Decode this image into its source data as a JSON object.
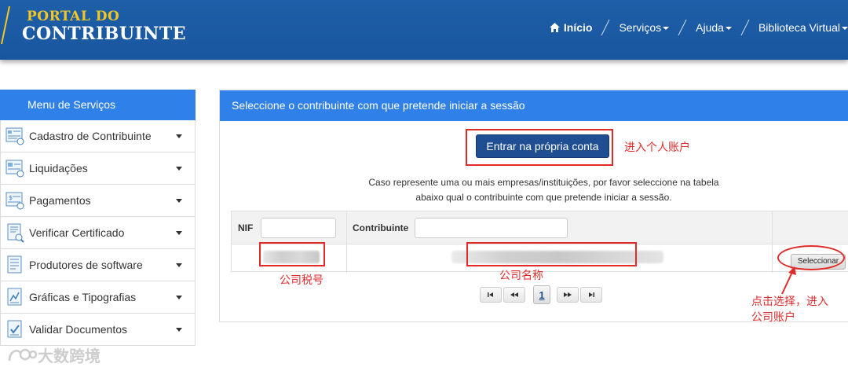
{
  "header": {
    "logo_top": "PORTAL DO",
    "logo_bottom": "CONTRIBUINTE",
    "nav": [
      {
        "label": "Início",
        "icon": "home-icon",
        "dropdown": false
      },
      {
        "label": "Serviços",
        "dropdown": true
      },
      {
        "label": "Ajuda",
        "dropdown": true
      },
      {
        "label": "Biblioteca Virtual",
        "dropdown": true
      }
    ],
    "colors": {
      "bar": "#1d5fa8",
      "logo_accent": "#f3c623"
    }
  },
  "sidebar": {
    "title": "Menu de Serviços",
    "items": [
      {
        "label": "Cadastro de Contribuinte",
        "icon": "registry-form-icon"
      },
      {
        "label": "Liquidações",
        "icon": "calculator-form-icon"
      },
      {
        "label": "Pagamentos",
        "icon": "payment-form-icon"
      },
      {
        "label": "Verificar Certificado",
        "icon": "certificate-check-icon"
      },
      {
        "label": "Produtores de software",
        "icon": "software-document-icon"
      },
      {
        "label": "Gráficas e Tipografias",
        "icon": "printing-document-icon"
      },
      {
        "label": "Validar Documentos",
        "icon": "document-check-icon"
      }
    ]
  },
  "main": {
    "title": "Seleccione o contribuinte com que pretende iniciar a sessão",
    "own_account_button": "Entrar na própria conta",
    "description_line1": "Caso represente uma ou mais empresas/instituições, por favor seleccione na tabela",
    "description_line2": "abaixo qual o contribuinte com que pretende iniciar a sessão.",
    "table": {
      "columns": [
        "NIF",
        "Contribuinte"
      ],
      "filter_nif_value": "",
      "filter_contribuinte_value": "",
      "rows": [
        {
          "nif": "",
          "contribuinte": "",
          "action": "Seleccionar"
        }
      ]
    },
    "pagination": {
      "current_page": "1",
      "buttons": [
        "first",
        "prev",
        "next",
        "last"
      ]
    },
    "colors": {
      "panel_header": "#2f80e9",
      "primary_button": "#1f4e92"
    }
  },
  "annotations": {
    "own_account_note": "进入个人账户",
    "nif_note": "公司税号",
    "name_note": "公司名称",
    "select_note_line1": "点击选择，进入",
    "select_note_line2": "公司账户",
    "color": "#e12b2b"
  },
  "watermark": {
    "text": "大数跨境"
  }
}
